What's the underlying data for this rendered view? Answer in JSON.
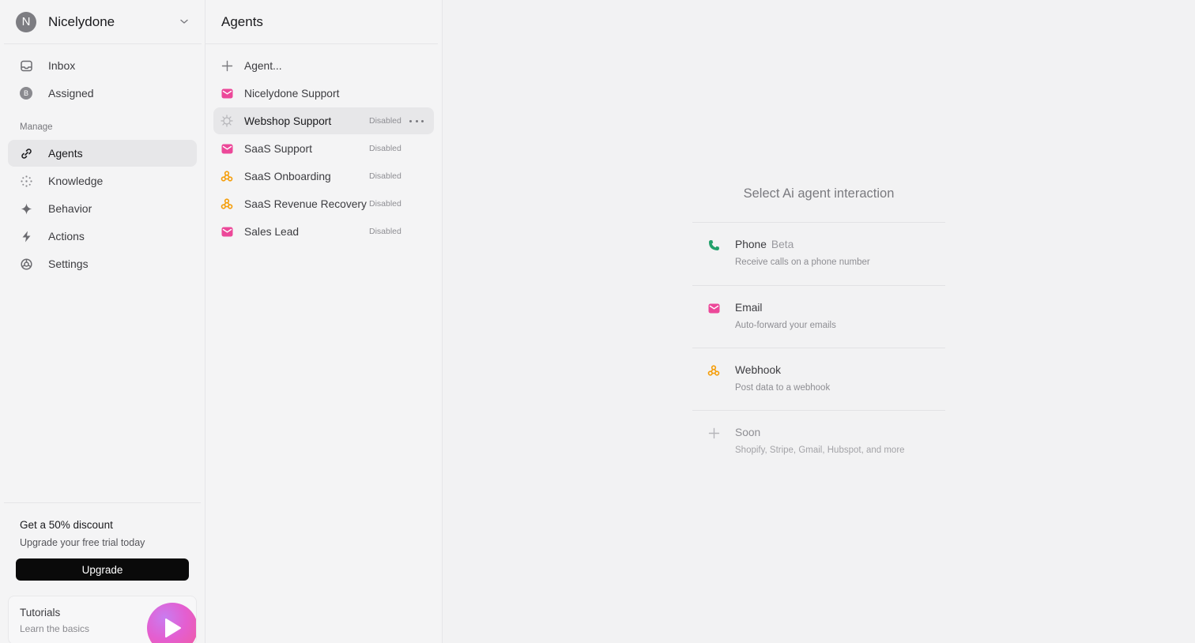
{
  "workspace": {
    "initial": "N",
    "name": "Nicelydone"
  },
  "nav": {
    "primary": [
      {
        "label": "Inbox",
        "icon": "inbox-icon"
      },
      {
        "label": "Assigned",
        "icon": "assigned-badge-icon",
        "badge": "B"
      }
    ],
    "section_label": "Manage",
    "manage": [
      {
        "label": "Agents",
        "icon": "link-icon",
        "active": true
      },
      {
        "label": "Knowledge",
        "icon": "knowledge-dots-icon"
      },
      {
        "label": "Behavior",
        "icon": "sparkle-icon"
      },
      {
        "label": "Actions",
        "icon": "lightning-icon"
      },
      {
        "label": "Settings",
        "icon": "settings-icon"
      }
    ]
  },
  "promo": {
    "title": "Get a 50% discount",
    "subtitle": "Upgrade your free trial today",
    "button": "Upgrade"
  },
  "tutorials": {
    "title": "Tutorials",
    "subtitle": "Learn the basics"
  },
  "agents": {
    "title": "Agents",
    "new_label": "Agent...",
    "items": [
      {
        "name": "Nicelydone Support",
        "status": "",
        "icon": "email-icon"
      },
      {
        "name": "Webshop Support",
        "status": "Disabled",
        "icon": "gear-outline-icon",
        "active": true
      },
      {
        "name": "SaaS Support",
        "status": "Disabled",
        "icon": "email-icon"
      },
      {
        "name": "SaaS Onboarding",
        "status": "Disabled",
        "icon": "webhook-icon"
      },
      {
        "name": "SaaS Revenue Recovery",
        "status": "Disabled",
        "icon": "webhook-icon"
      },
      {
        "name": "Sales Lead",
        "status": "Disabled",
        "icon": "email-icon"
      }
    ]
  },
  "main": {
    "title": "Select Ai agent interaction",
    "options": [
      {
        "title": "Phone",
        "badge": "Beta",
        "description": "Receive calls on a phone number",
        "icon": "phone-icon"
      },
      {
        "title": "Email",
        "badge": "",
        "description": "Auto-forward your emails",
        "icon": "email-icon"
      },
      {
        "title": "Webhook",
        "badge": "",
        "description": "Post data to a webhook",
        "icon": "webhook-icon"
      },
      {
        "title": "Soon",
        "badge": "",
        "description": "Shopify, Stripe, Gmail, Hubspot, and more",
        "icon": "plus-icon"
      }
    ]
  },
  "colors": {
    "email": "#ec4899",
    "webhook": "#f59e0b",
    "phone": "#22a06b",
    "accent_button": "#0a0a0a"
  }
}
